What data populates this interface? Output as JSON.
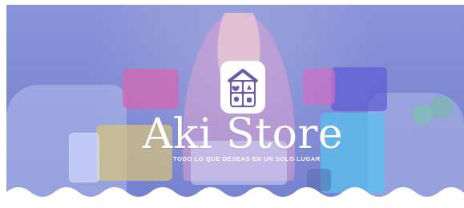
{
  "store": {
    "name": "Aki Store",
    "tagline": "TODO LO QUE DESEAS EN UN SOLO LUGAR"
  },
  "icons": {
    "logo": "store-logo-icon",
    "wave": "wave-edge-decoration"
  },
  "colors": {
    "overlay": "#7f8ad3",
    "text": "#ffffff",
    "logo_purple": "#6b5aa6"
  }
}
